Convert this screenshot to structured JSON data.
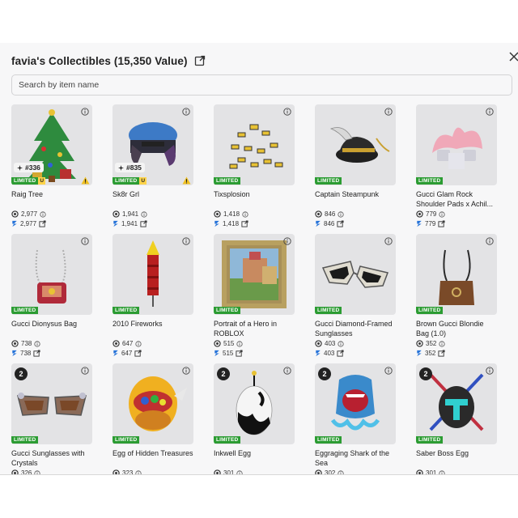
{
  "header": {
    "title": "favia's Collectibles (15,350 Value)"
  },
  "search": {
    "placeholder": "Search by item name"
  },
  "badge": {
    "limited": "LIMITED",
    "unique": "U"
  },
  "items": [
    {
      "name": "Raig Tree",
      "rap": "2,977",
      "value": "2,977",
      "serial": "#336",
      "unique": true,
      "warn": true,
      "art": "tree-icon"
    },
    {
      "name": "Sk8r Grl",
      "rap": "1,941",
      "value": "1,941",
      "serial": "#835",
      "unique": true,
      "warn": true,
      "art": "hair-icon"
    },
    {
      "name": "Tixsplosion",
      "rap": "1,418",
      "value": "1,418",
      "art": "tix-icon"
    },
    {
      "name": "Captain Steampunk",
      "rap": "846",
      "value": "846",
      "art": "hat-icon"
    },
    {
      "name": "Gucci Glam Rock Shoulder Pads x Achil...",
      "rap": "779",
      "value": "779",
      "art": "shoulder-pads-icon"
    },
    {
      "name": "Gucci Dionysus Bag",
      "rap": "738",
      "value": "738",
      "art": "bag-icon"
    },
    {
      "name": "2010 Fireworks",
      "rap": "647",
      "value": "647",
      "art": "firework-icon"
    },
    {
      "name": "Portrait of a Hero in ROBLOX",
      "rap": "515",
      "value": "515",
      "art": "portrait-icon"
    },
    {
      "name": "Gucci Diamond-Framed Sunglasses",
      "rap": "403",
      "value": "403",
      "art": "sunglasses-icon"
    },
    {
      "name": "Brown Gucci Blondie Bag (1.0)",
      "rap": "352",
      "value": "352",
      "art": "brown-bag-icon"
    },
    {
      "name": "Gucci Sunglasses with Crystals",
      "rap": "326",
      "rank": "2",
      "art": "crystal-sunglasses-icon"
    },
    {
      "name": "Egg of Hidden Treasures",
      "rap": "323",
      "art": "egg-treasure-icon"
    },
    {
      "name": "Inkwell Egg",
      "rap": "301",
      "rank": "2",
      "art": "ink-egg-icon"
    },
    {
      "name": "Eggraging Shark of the Sea",
      "rap": "302",
      "rank": "2",
      "art": "shark-icon"
    },
    {
      "name": "Saber Boss Egg",
      "rap": "301",
      "rank": "2",
      "art": "saber-egg-icon"
    }
  ]
}
